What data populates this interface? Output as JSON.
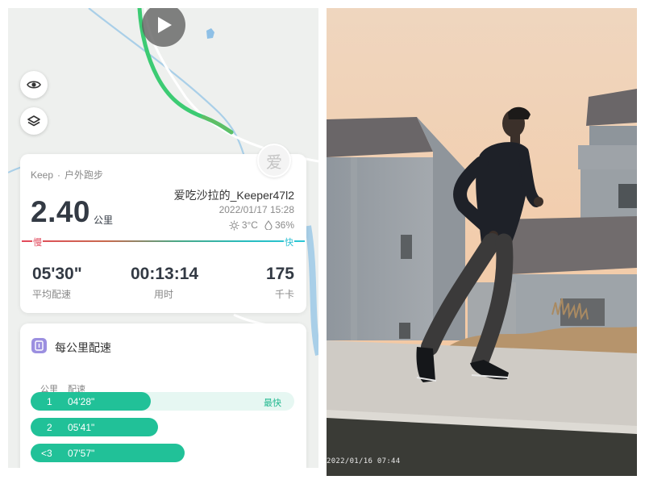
{
  "map": {
    "play_icon": "play-icon",
    "eye_icon": "eye-icon",
    "layers_icon": "layers-icon",
    "colors": {
      "route": "#3ccb73",
      "route_end": "#2ebd68",
      "river": "#a9cfe8",
      "road": "#ffffff"
    }
  },
  "summary": {
    "avatar_char": "爱",
    "source_app": "Keep",
    "separator": "·",
    "activity_type": "户外跑步",
    "distance": "2.40",
    "distance_unit": "公里",
    "username": "爱吃沙拉的_Keeper47l2",
    "datetime": "2022/01/17 15:28",
    "temperature": "3°C",
    "humidity": "36%",
    "speed_scale": {
      "slow_label": "慢",
      "fast_label": "快"
    },
    "stats": [
      {
        "value": "05'30\"",
        "label": "平均配速"
      },
      {
        "value": "00:13:14",
        "label": "用时"
      },
      {
        "value": "175",
        "label": "千卡"
      }
    ]
  },
  "pace": {
    "title": "每公里配速",
    "col_km": "公里",
    "col_pace": "配速",
    "fastest_label": "最快",
    "rows": [
      {
        "km": "1",
        "pace": "04'28\"",
        "fraction": 0.455
      },
      {
        "km": "2",
        "pace": "05'41\"",
        "fraction": 0.482
      },
      {
        "km": "<3",
        "pace": "07'57\"",
        "fraction": 0.585
      }
    ]
  },
  "photo": {
    "timestamp": "2022/01/16 07:44",
    "colors": {
      "sky_top": "#eed3b8",
      "sky_bottom": "#f6c8a0",
      "wall": "#9aa0a6",
      "roof": "#6a6668",
      "ground": "#cdcac4",
      "shirt": "#1e2128",
      "pants": "#3b3a3a"
    }
  }
}
